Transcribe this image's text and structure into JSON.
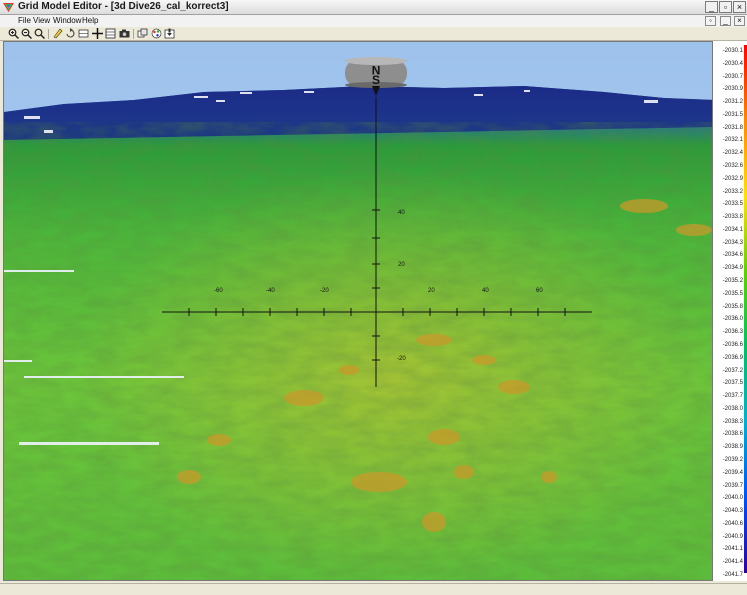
{
  "window": {
    "title": "Grid Model Editor - [3d Dive26_cal_korrect3]"
  },
  "menu": {
    "items": [
      "File",
      "View",
      "Window",
      "Help"
    ]
  },
  "toolbar": {
    "tools": [
      "zoom-in-icon",
      "zoom-out-icon",
      "zoom-fit-icon",
      "highlight-icon",
      "rotate-icon",
      "pan-icon",
      "crosshair-icon",
      "grid-icon",
      "camera-icon",
      "layers-icon",
      "palette-icon",
      "export-icon"
    ]
  },
  "compass": {
    "north": "N",
    "south": "S"
  },
  "axes": {
    "horizontal_ticks": [
      "-60",
      "-40",
      "-20",
      "20",
      "40",
      "60"
    ],
    "vertical_ticks": [
      "40",
      "20",
      "-20"
    ]
  },
  "color_scale": {
    "labels": [
      "-2030.1",
      "-2030.4",
      "-2030.7",
      "-2030.9",
      "-2031.2",
      "-2031.5",
      "-2031.8",
      "-2032.1",
      "-2032.4",
      "-2032.6",
      "-2032.9",
      "-2033.2",
      "-2033.5",
      "-2033.8",
      "-2034.1",
      "-2034.3",
      "-2034.6",
      "-2034.9",
      "-2035.2",
      "-2035.5",
      "-2035.8",
      "-2036.0",
      "-2036.3",
      "-2036.6",
      "-2036.9",
      "-2037.2",
      "-2037.5",
      "-2037.7",
      "-2038.0",
      "-2038.3",
      "-2038.6",
      "-2038.9",
      "-2039.2",
      "-2039.4",
      "-2039.7",
      "-2040.0",
      "-2040.3",
      "-2040.6",
      "-2040.9",
      "-2041.1",
      "-2041.4",
      "-2041.7"
    ]
  },
  "colors": {
    "sky": "#a9c8ea",
    "terrain_green": "#55bb33",
    "deep_blue": "#1a2a8a"
  }
}
